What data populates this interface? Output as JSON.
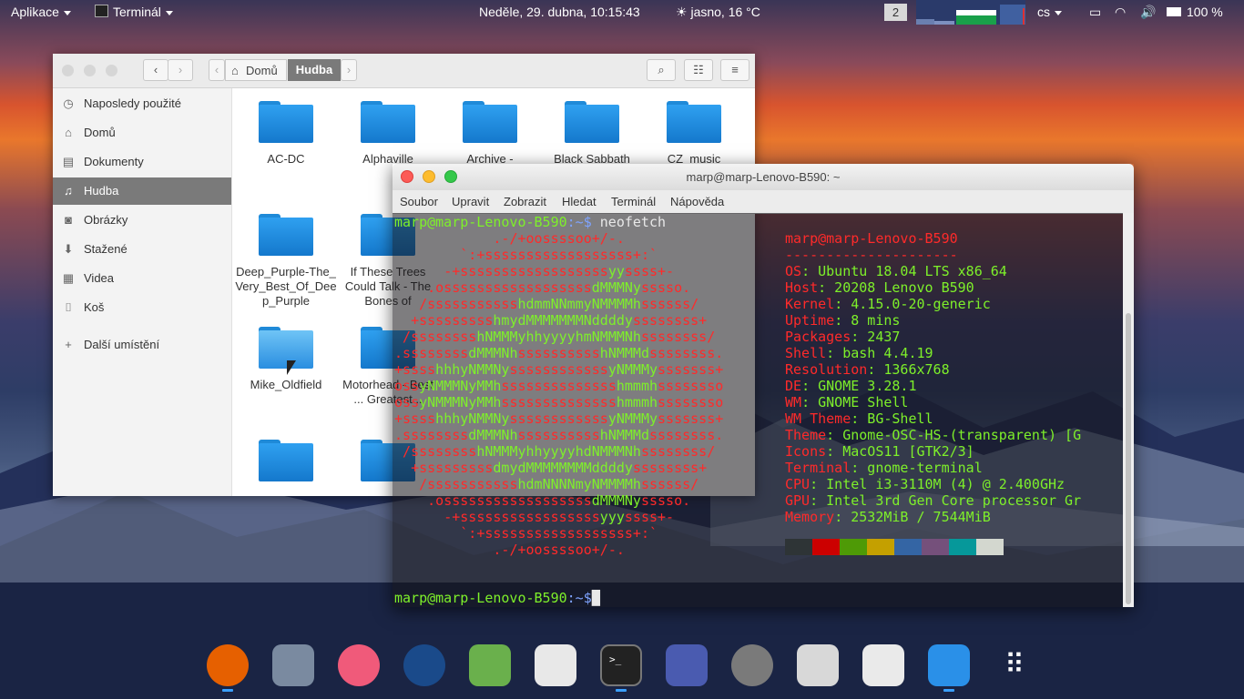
{
  "topbar": {
    "apps_menu": "Aplikace",
    "active_app": "Terminál",
    "datetime": "Neděle, 29. dubna, 10:15:43",
    "weather": "jasno, 16 °C",
    "workspace": "2",
    "keyboard": "cs",
    "battery": "100 %"
  },
  "files": {
    "breadcrumb": [
      "Domů",
      "Hudba"
    ],
    "sidebar": [
      {
        "label": "Naposledy použité",
        "icon": "clock-icon"
      },
      {
        "label": "Domů",
        "icon": "home-icon"
      },
      {
        "label": "Dokumenty",
        "icon": "document-icon"
      },
      {
        "label": "Hudba",
        "icon": "music-icon"
      },
      {
        "label": "Obrázky",
        "icon": "camera-icon"
      },
      {
        "label": "Stažené",
        "icon": "download-icon"
      },
      {
        "label": "Videa",
        "icon": "film-icon"
      },
      {
        "label": "Koš",
        "icon": "trash-icon"
      },
      {
        "label": "Další umístění",
        "icon": "plus-icon"
      }
    ],
    "folders": [
      "AC-DC",
      "Alphaville",
      "Archive -",
      "Black Sabbath",
      "CZ_music",
      "Deep_Purple-The_Very_Best_Of_Deep_Purple",
      "If These Trees Could Talk - The Bones of",
      "Mike_Oldfield",
      "Motorhead - Best ... Greatest..."
    ]
  },
  "terminal": {
    "title": "marp@marp-Lenovo-B590: ~",
    "menu": [
      "Soubor",
      "Upravit",
      "Zobrazit",
      "Hledat",
      "Terminál",
      "Nápověda"
    ],
    "prompt_user": "marp@marp-Lenovo-B590",
    "prompt_path": ":~$",
    "command": " neofetch",
    "logo": [
      "            .-/+oossssoo+/-.",
      "        `:+ssssssssssssssssss+:`",
      "      -+ssssssssssssssssssyyssss+-",
      "    .ossssssssssssssssssdMMMNysssso.",
      "   /ssssssssssshdmmNNmmyNMMMMhssssss/",
      "  +ssssssssshmydMMMMMMMNddddyssssssss+",
      " /sssssssshNMMMyhhyyyyhmNMMMNhssssssss/",
      ".ssssssssdMMMNhsssssssssshNMMMdssssssss.",
      "+sssshhhyNMMNyssssssssssssyNMMMysssssss+",
      "ossyNMMMNyMMhsssssssssssssshmmmhssssssso",
      "ossyNMMMNyMMhsssssssssssssshmmmhssssssso",
      "+sssshhhyNMMNyssssssssssssyNMMMysssssss+",
      ".ssssssssdMMMNhsssssssssshNMMMdssssssss.",
      " /sssssssshNMMMyhhyyyyhdNMMMNhssssssss/",
      "  +sssssssssdmydMMMMMMMMddddyssssssss+",
      "   /ssssssssssshdmNNNNmyNMMMMhssssss/",
      "    .ossssssssssssssssssdMMMNysssso.",
      "      -+sssssssssssssssssyyyssss+-",
      "        `:+ssssssssssssssssss+:`",
      "            .-/+oossssoo+/-."
    ],
    "info_user": "marp@marp-Lenovo-B590",
    "separator": "---------------------",
    "info": [
      {
        "k": "OS",
        "v": ": Ubuntu 18.04 LTS x86_64"
      },
      {
        "k": "Host",
        "v": ": 20208 Lenovo B590"
      },
      {
        "k": "Kernel",
        "v": ": 4.15.0-20-generic"
      },
      {
        "k": "Uptime",
        "v": ": 8 mins"
      },
      {
        "k": "Packages",
        "v": ": 2437"
      },
      {
        "k": "Shell",
        "v": ": bash 4.4.19"
      },
      {
        "k": "Resolution",
        "v": ": 1366x768"
      },
      {
        "k": "DE",
        "v": ": GNOME 3.28.1"
      },
      {
        "k": "WM",
        "v": ": GNOME Shell"
      },
      {
        "k": "WM Theme",
        "v": ": BG-Shell"
      },
      {
        "k": "Theme",
        "v": ": Gnome-OSC-HS-(transparent) [G"
      },
      {
        "k": "Icons",
        "v": ": MacOS11 [GTK2/3]"
      },
      {
        "k": "Terminal",
        "v": ": gnome-terminal"
      },
      {
        "k": "CPU",
        "v": ": Intel i3-3110M (4) @ 2.400GHz"
      },
      {
        "k": "GPU",
        "v": ": Intel 3rd Gen Core processor Gr"
      },
      {
        "k": "Memory",
        "v": ": 2532MiB / 7544MiB"
      }
    ],
    "palette": [
      "#2e3436",
      "#cc0000",
      "#4e9a06",
      "#c4a000",
      "#3465a4",
      "#75507b",
      "#06989a",
      "#d3d7cf"
    ]
  },
  "dock": {
    "apps": [
      {
        "name": "firefox-icon",
        "color": "#e66000"
      },
      {
        "name": "mail-icon",
        "color": "#7a8aa0"
      },
      {
        "name": "music-app-icon",
        "color": "#f05a7a"
      },
      {
        "name": "browser-icon",
        "color": "#1a4a8a"
      },
      {
        "name": "maps-icon",
        "color": "#6ab04c"
      },
      {
        "name": "text-editor-icon",
        "color": "#e8e8e8"
      },
      {
        "name": "terminal-icon",
        "color": "#222222"
      },
      {
        "name": "software-center-icon",
        "color": "#4a5bb0"
      },
      {
        "name": "settings-icon",
        "color": "#7a7a7a"
      },
      {
        "name": "calculator-icon",
        "color": "#d8d8d8"
      },
      {
        "name": "screenshot-icon",
        "color": "#eaeaea"
      },
      {
        "name": "finder-icon",
        "color": "#2a90e8"
      },
      {
        "name": "app-grid-icon",
        "color": "#ffffff"
      }
    ]
  }
}
